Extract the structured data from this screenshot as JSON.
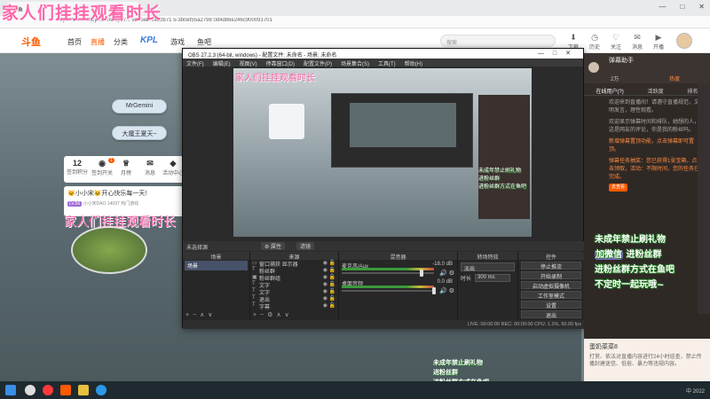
{
  "overlay": {
    "banner": "家人们挂挂观看时长"
  },
  "browser": {
    "tab_title": "斗鱼",
    "url": "https://www.douyu.com/topic/... 9a0beb 6e82b71 5-3b0ef55a2798 0d4d86e246c900091701",
    "controls": [
      "—",
      "□",
      "✕"
    ]
  },
  "site": {
    "logo": "斗鱼",
    "nav": [
      "首页",
      "直播",
      "分类",
      "KPL",
      "游戏",
      "鱼吧"
    ],
    "search_placeholder": "搜索",
    "top_icons": [
      {
        "label": "下载",
        "icon": "download-icon"
      },
      {
        "label": "历史",
        "icon": "history-icon"
      },
      {
        "label": "关注",
        "icon": "follow-icon"
      },
      {
        "label": "消息",
        "icon": "message-icon"
      },
      {
        "label": "开播",
        "icon": "broadcast-icon"
      }
    ]
  },
  "stream": {
    "pill_1": "MrGemini",
    "pill_2": "大魔王夏天~",
    "stats": [
      {
        "value": "12",
        "label": "签到积分"
      },
      {
        "value": "",
        "label": "签到开关"
      },
      {
        "value": "",
        "label": "月榜"
      },
      {
        "value": "",
        "label": "消息"
      },
      {
        "value": "",
        "label": "活动中心"
      }
    ],
    "stat_badge": "1",
    "post_title": "🐱小小宋🐱开心快乐每一天!",
    "post_level": "LV.56",
    "post_meta_1": "小小宋DAO",
    "post_meta_2": "14097",
    "post_meta_3": "热门游戏",
    "overlay_text": "家人们挂挂观看时长"
  },
  "obs": {
    "title": "OBS 27.2.3 (64-bit, windows) - 配置文件: 未命名 - 场景: 未命名",
    "menu": [
      "文件(F)",
      "编辑(E)",
      "视图(V)",
      "停靠窗口(D)",
      "配置文件(P)",
      "场景集合(S)",
      "工具(T)",
      "帮助(H)"
    ],
    "preview_banner": "家人们挂挂观看时长",
    "no_source": "未选择源",
    "properties": "属性",
    "filters": "滤镜",
    "docks": {
      "scenes": "场景",
      "sources": "来源",
      "mixer": "混音器",
      "transitions": "转场特效",
      "controls": "控件"
    },
    "scene_items": [
      "场景"
    ],
    "sources": [
      {
        "name": "窗口捕获 显示器",
        "icon": "monitor-icon"
      },
      {
        "name": "粉丝群",
        "icon": "text-icon"
      },
      {
        "name": "粉丝群组",
        "icon": "image-icon"
      },
      {
        "name": "文字",
        "icon": "text-icon"
      },
      {
        "name": "文字",
        "icon": "text-icon"
      },
      {
        "name": "退出",
        "icon": "text-icon"
      },
      {
        "name": "字幕",
        "icon": "text-icon"
      }
    ],
    "mixer": [
      {
        "name": "麦克风/Aux",
        "db": "-18.0 dB",
        "knob": 0.85
      },
      {
        "name": "桌面音频",
        "db": "0.0 dB",
        "knob": 0.98
      }
    ],
    "transition_select": "淡出",
    "transition_duration_label": "时长",
    "transition_duration": "300 ms",
    "control_buttons": [
      "停止推流",
      "开始录制",
      "启动虚拟摄像机",
      "工作室模式",
      "设置",
      "退出"
    ],
    "status": "LIVE: 00:00:00     REC: 00:00:00     CPU: 1.1%, 60.00 fps"
  },
  "right_panel": {
    "assistant_title": "弹幕助手",
    "likes": "2万",
    "hot": "热度",
    "tabs": [
      "在线用户(?)",
      "活跃度",
      "排名"
    ],
    "messages": [
      "欢迎来到直播间！请遵守直播规范，文明发言，理性观看。",
      "欢迎显示弹幕时间和排队，她想的人，这是网友的评论，你是我的粉丝吗。",
      "新增弹幕置顶功能，点击弹幕即可置顶。"
    ],
    "task": "弹幕任务抽奖：您已获得1张宝箱，点击领取，活动：不限时间，您的任务已完成。",
    "task_done": "去查看",
    "promo": [
      "未成年禁止刷礼物",
      "加微信",
      "进粉丝群",
      "进粉丝群方式在鱼吧",
      "不定时一起玩哦~"
    ],
    "bottom_title": "蛋奶菜菜8",
    "bottom_text": "打赏、依法对直播内容进行24小时巡查，禁止传播封建迷信、低俗、暴力等违规内容。"
  },
  "promo2": [
    "未成年禁止刷礼物",
    "进粉丝群",
    "进粉丝群方式在鱼吧"
  ],
  "taskbar": {
    "right_text": "中  2022"
  }
}
